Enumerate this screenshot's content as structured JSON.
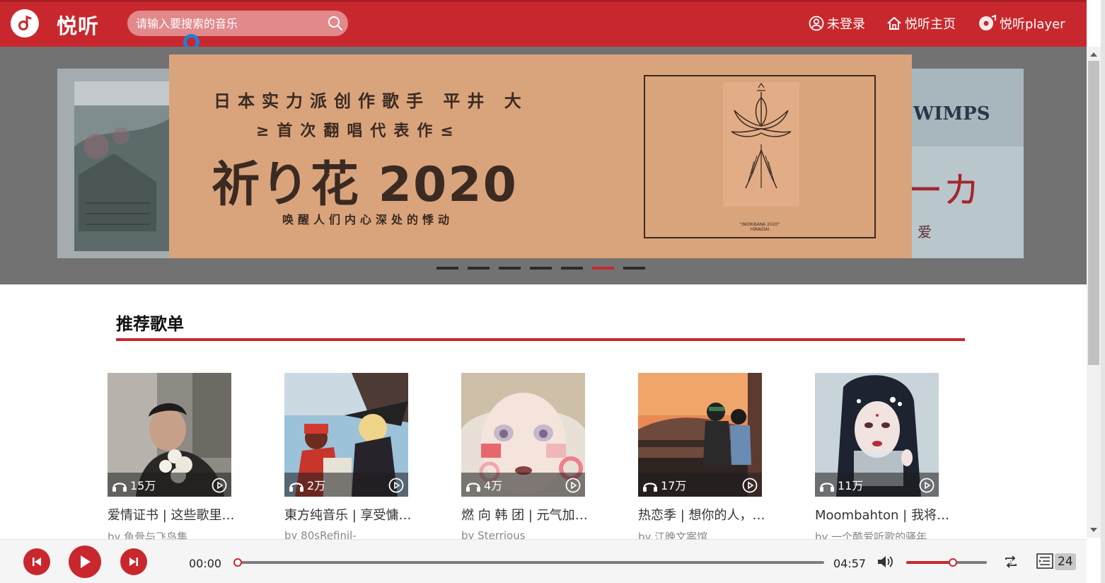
{
  "header": {
    "logo_text": "悦听",
    "search_placeholder": "请输入要搜索的音乐",
    "nav": [
      {
        "label": "未登录",
        "icon": "user-icon"
      },
      {
        "label": "悦听主页",
        "icon": "home-icon"
      },
      {
        "label": "悦听player",
        "icon": "music-disc-icon"
      }
    ]
  },
  "banner": {
    "line1": "日本实力派创作歌手 平井 大",
    "line2": "≥首次翻唱代表作≤",
    "line3": "祈り花 2020",
    "line4": "唤醒人们内心深处的悸动",
    "album_caption_1": "\"INORIBANA 2020\"",
    "album_caption_2": "HIRAIDAI",
    "right_peek_text": "WIMPS",
    "right_peek_kana": "ーカ",
    "right_peek_small": "爱",
    "dot_count": 7,
    "active_dot": 6
  },
  "section": {
    "title": "推荐歌单"
  },
  "playlists": [
    {
      "count": "15万",
      "title": "爱情证书 | 这些歌里，有你想说的情话",
      "by": "by 鱼骨与飞鸟集"
    },
    {
      "count": "2万",
      "title": "東方纯音乐 | 享受慵懒的午后时光",
      "by": "by 80sRefinil-"
    },
    {
      "count": "4万",
      "title": "燃 向 韩 团 | 元气加油站",
      "by": "by Sterrious"
    },
    {
      "count": "17万",
      "title": "热恋季 | 想你的人，你想的人",
      "by": "by 江晚文案馆"
    },
    {
      "count": "11万",
      "title": "Moombahton | 我将在你的世界里",
      "by": "by 一个酷爱听歌的骚年"
    }
  ],
  "player": {
    "current_time": "00:00",
    "total_time": "04:57",
    "progress_fraction": 0.0,
    "volume_fraction": 0.58,
    "playlist_count": "24"
  },
  "colors": {
    "accent": "#c8282d",
    "banner_bg": "#737273",
    "slide_bg": "#d9a47c"
  }
}
